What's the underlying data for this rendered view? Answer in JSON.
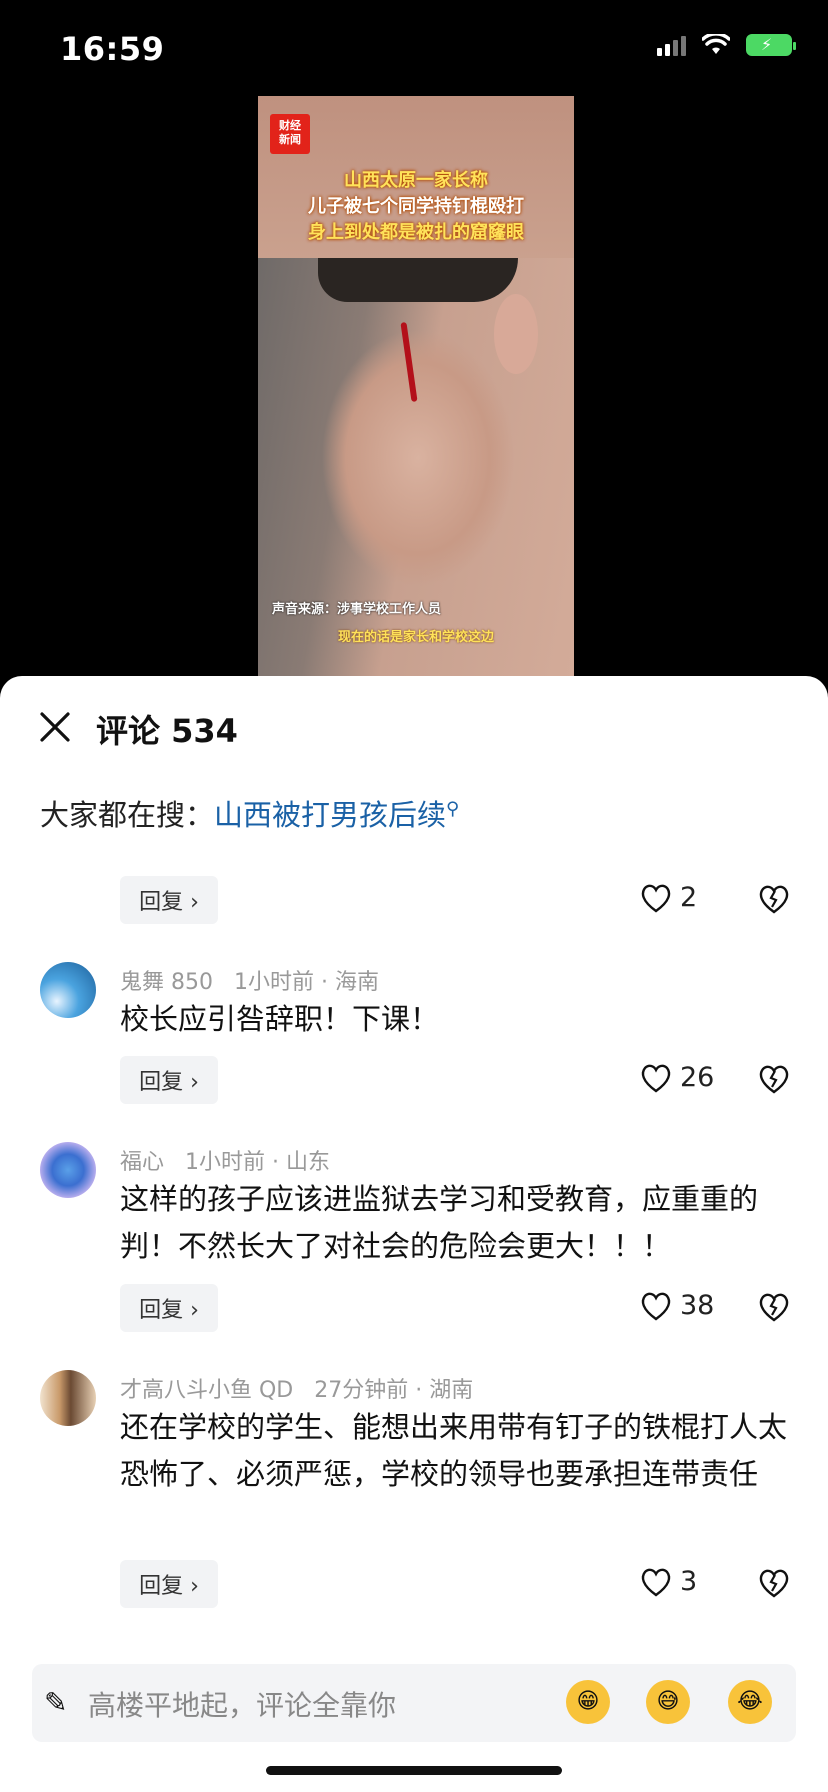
{
  "status": {
    "time": "16:59"
  },
  "video": {
    "logo": "财经\n新闻",
    "headline_line1": "山西太原一家长称",
    "headline_line2": "儿子被七个同学持钉棍殴打",
    "headline_line3": "身上到处都是被扎的窟窿眼",
    "source_label": "声音来源：涉事学校工作人员",
    "subtitle": "现在的话是家长和学校这边"
  },
  "panel": {
    "title": "评论 534",
    "search_label": "大家都在搜：",
    "search_query": "山西被打男孩后续"
  },
  "first_reply": {
    "reply_label": "回复 ›",
    "likes": "2"
  },
  "comments": [
    {
      "user": "鬼舞 850",
      "time_loc": "1小时前 · 海南",
      "text": "校长应引咎辞职！下课！",
      "reply_label": "回复 ›",
      "likes": "26"
    },
    {
      "user": "福心",
      "time_loc": "1小时前 · 山东",
      "text": "这样的孩子应该进监狱去学习和受教育，应重重的判！不然长大了对社会的危险会更大！！！",
      "reply_label": "回复 ›",
      "likes": "38"
    },
    {
      "user": "才高八斗小鱼 QD",
      "time_loc": "27分钟前 · 湖南",
      "text": "还在学校的学生、能想出来用带有钉子的铁棍打人太恐怖了、必须严惩，学校的领导也要承担连带责任",
      "reply_label": "回复 ›",
      "likes": "3"
    }
  ],
  "input": {
    "placeholder": "高楼平地起，评论全靠你"
  },
  "emojis": [
    "😁",
    "😅",
    "😂"
  ],
  "colors": {
    "link": "#1a61a6",
    "battery": "#4cd964"
  }
}
